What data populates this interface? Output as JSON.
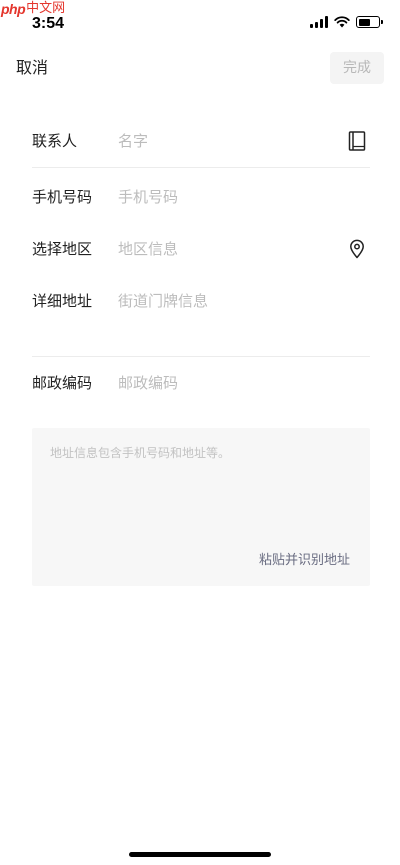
{
  "watermark": {
    "logo": "php",
    "text": "中文网"
  },
  "status_bar": {
    "time": "3:54"
  },
  "nav": {
    "cancel_label": "取消",
    "done_label": "完成"
  },
  "form": {
    "contact": {
      "label": "联系人",
      "placeholder": "名字"
    },
    "phone": {
      "label": "手机号码",
      "placeholder": "手机号码"
    },
    "region": {
      "label": "选择地区",
      "placeholder": "地区信息"
    },
    "address": {
      "label": "详细地址",
      "placeholder": "街道门牌信息"
    },
    "postcode": {
      "label": "邮政编码",
      "placeholder": "邮政编码"
    }
  },
  "paste": {
    "hint": "地址信息包含手机号码和地址等。",
    "action_label": "粘贴并识别地址"
  },
  "icons": {
    "contact_book": "address-book-icon",
    "location": "location-pin-icon"
  },
  "colors": {
    "placeholder": "#bcbcbc",
    "paste_action": "#6a6d82",
    "watermark": "#e4362d"
  }
}
